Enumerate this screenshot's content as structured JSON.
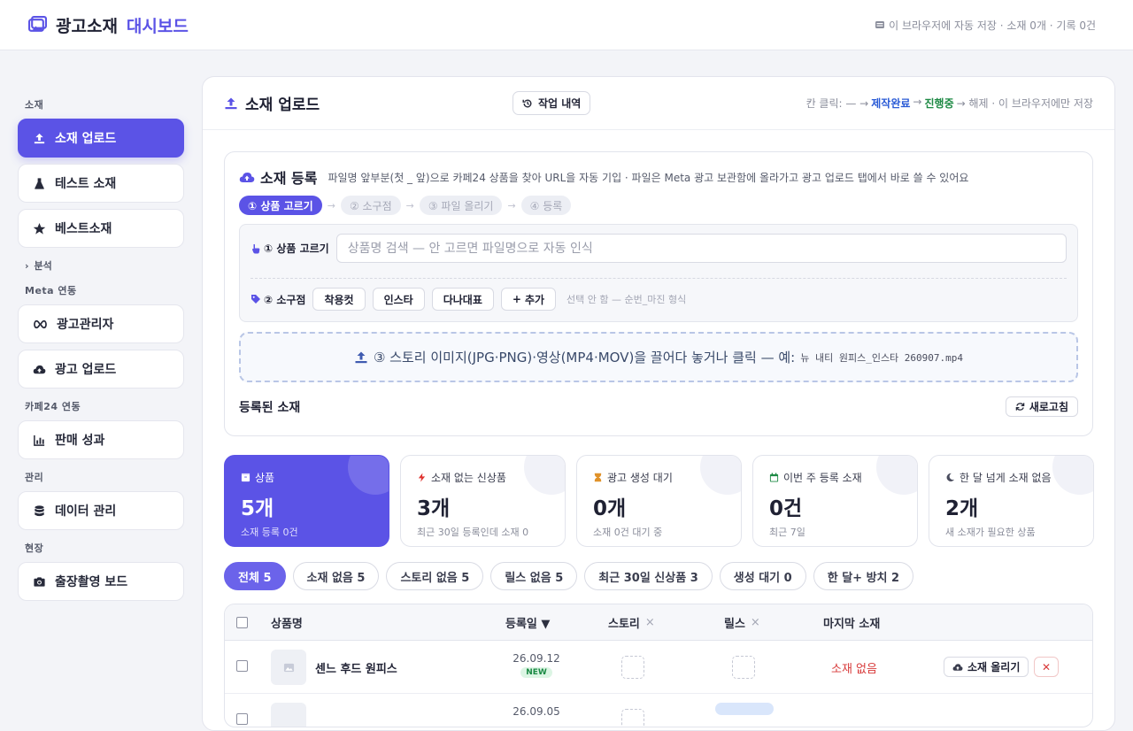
{
  "header": {
    "brand_main": "광고소재",
    "brand_accent": "대시보드",
    "storage_text": "이 브라우저에 자동 저장 · 소재 0개 · 기록 0건"
  },
  "sidebar": {
    "group_material": "소재",
    "upload": "소재 업로드",
    "test": "테스트 소재",
    "best": "베스트소재",
    "analysis": "분석",
    "group_meta": "Meta 연동",
    "ads_manager": "광고관리자",
    "ad_upload": "광고 업로드",
    "group_cafe24": "카페24 연동",
    "sales": "판매 성과",
    "group_manage": "관리",
    "data_manage": "데이터 관리",
    "group_field": "현장",
    "shoot_board": "출장촬영 보드"
  },
  "main": {
    "title": "소재 업로드",
    "history_btn": "작업 내역",
    "hint_prefix": "칸 클릭: — →",
    "hint_done": "제작완료",
    "hint_arrow": "→",
    "hint_progress": "진행중",
    "hint_suffix": "→ 해제 · 이 브라우저에만 저장"
  },
  "register": {
    "title": "소재 등록",
    "desc": "파일명 앞부분(첫 _ 앞)으로 카페24 상품을 찾아 URL을 자동 기입 · 파일은 Meta 광고 보관함에 올라가고 광고 업로드 탭에서 바로 쓸 수 있어요",
    "steps": [
      "① 상품 고르기",
      "② 소구점",
      "③ 파일 올리기",
      "④ 등록"
    ],
    "pick_label": "① 상품 고르기",
    "pick_placeholder": "상품명 검색 — 안 고르면 파일명으로 자동 인식",
    "appeal_label": "② 소구점",
    "chips": [
      "착용컷",
      "인스타",
      "다나대표"
    ],
    "add_chip": "추가",
    "appeal_hint": "선택 안 함 — 순번_마진 형식",
    "drop_text": "③ 스토리 이미지(JPG·PNG)·영상(MP4·MOV)을 끌어다 놓거나 클릭 — 예:",
    "drop_example": "뉴 내티 원피스_인스타 260907.mp4",
    "registered_label": "등록된 소재",
    "refresh_btn": "새로고침"
  },
  "stats": [
    {
      "label": "상품",
      "value": "5개",
      "sub": "소재 등록 0건",
      "icon": "box-icon"
    },
    {
      "label": "소재 없는 신상품",
      "value": "3개",
      "sub": "최근 30일 등록인데 소재 0",
      "icon": "bolt-icon"
    },
    {
      "label": "광고 생성 대기",
      "value": "0개",
      "sub": "소재 0건 대기 중",
      "icon": "hourglass-icon"
    },
    {
      "label": "이번 주 등록 소재",
      "value": "0건",
      "sub": "최근 7일",
      "icon": "calendar-icon"
    },
    {
      "label": "한 달 넘게 소재 없음",
      "value": "2개",
      "sub": "새 소재가 필요한 상품",
      "icon": "moon-icon"
    }
  ],
  "filters": [
    "전체 5",
    "소재 없음 5",
    "스토리 없음 5",
    "릴스 없음 5",
    "최근 30일 신상품 3",
    "생성 대기 0",
    "한 달+ 방치 2"
  ],
  "table": {
    "col_name": "상품명",
    "col_date": "등록일 ▼",
    "col_story": "스토리",
    "col_reels": "릴스",
    "col_last": "마지막 소재",
    "close_mark": "×",
    "rows": [
      {
        "name": "센느 후드 원피스",
        "date": "26.09.12",
        "badge": "NEW",
        "last": "소재 없음",
        "upload": "소재 올리기",
        "delete": "✕"
      },
      {
        "date": "26.09.05"
      }
    ]
  },
  "colors": {
    "accent": "#5b53e6",
    "danger": "#d83a3a",
    "success": "#1e8a45",
    "link": "#2a5bd6"
  }
}
